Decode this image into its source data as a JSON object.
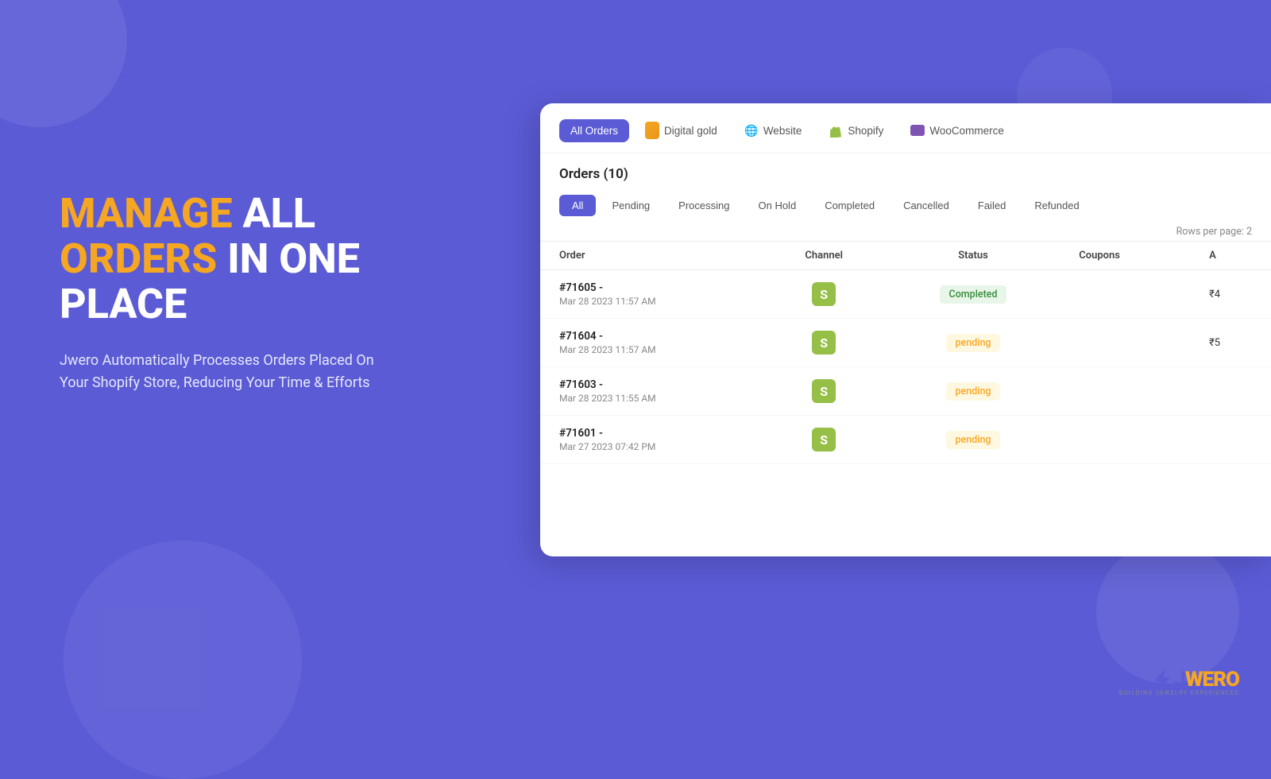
{
  "hero": {
    "heading_orange1": "MANAGE",
    "heading_white1": " ALL",
    "heading_orange2": "ORDERS",
    "heading_white2": " IN ONE",
    "heading_white3": "PLACE",
    "subtext": "Jwero Automatically Processes Orders Placed On Your Shopify Store, Reducing Your Time & Efforts"
  },
  "channel_tabs": [
    {
      "label": "All Orders",
      "active": true,
      "icon": ""
    },
    {
      "label": "Digital gold",
      "active": false,
      "icon": "dg"
    },
    {
      "label": "Website",
      "active": false,
      "icon": "globe"
    },
    {
      "label": "Shopify",
      "active": false,
      "icon": "shopify"
    },
    {
      "label": "WooCommerce",
      "active": false,
      "icon": "woo"
    }
  ],
  "orders_title": "Orders (10)",
  "status_tabs": [
    {
      "label": "All",
      "active": true
    },
    {
      "label": "Pending",
      "active": false
    },
    {
      "label": "Processing",
      "active": false
    },
    {
      "label": "On Hold",
      "active": false
    },
    {
      "label": "Completed",
      "active": false
    },
    {
      "label": "Cancelled",
      "active": false
    },
    {
      "label": "Failed",
      "active": false
    },
    {
      "label": "Refunded",
      "active": false
    }
  ],
  "rows_per_page_label": "Rows per page:",
  "rows_per_page_value": "2",
  "table": {
    "headers": [
      "Order",
      "Channel",
      "Status",
      "Coupons",
      "A"
    ],
    "rows": [
      {
        "id": "#71605 -",
        "date": "Mar 28 2023 11:57 AM",
        "channel": "shopify",
        "status": "Completed",
        "status_type": "completed",
        "coupons": "",
        "amount": "₹4"
      },
      {
        "id": "#71604 -",
        "date": "Mar 28 2023 11:57 AM",
        "channel": "shopify",
        "status": "pending",
        "status_type": "pending",
        "coupons": "",
        "amount": "₹5"
      },
      {
        "id": "#71603 -",
        "date": "Mar 28 2023 11:55 AM",
        "channel": "shopify",
        "status": "pending",
        "status_type": "pending",
        "coupons": "",
        "amount": ""
      },
      {
        "id": "#71601 -",
        "date": "Mar 27 2023 07:42 PM",
        "channel": "shopify",
        "status": "pending",
        "status_type": "pending",
        "coupons": "",
        "amount": ""
      }
    ]
  },
  "logo": {
    "j": "J",
    "wero": "WERO",
    "subtext": "BUILDING JEWELRY EXPERIENCES"
  }
}
